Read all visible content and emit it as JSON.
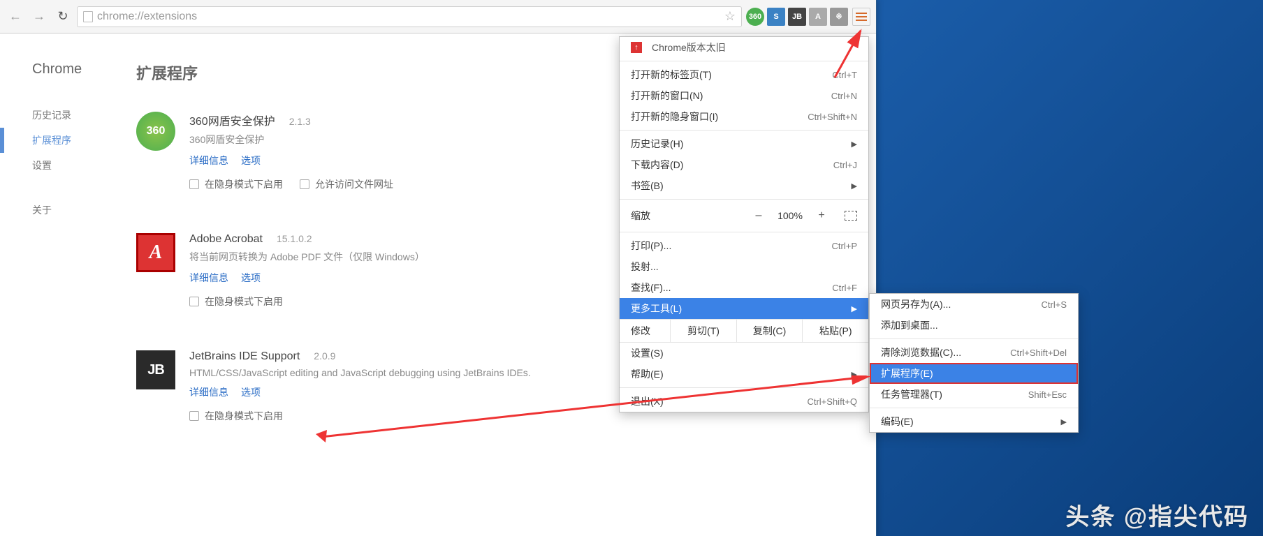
{
  "toolbar": {
    "url": "chrome://extensions",
    "ext_icons": [
      "360",
      "S",
      "JB",
      "A",
      "※"
    ]
  },
  "sidebar": {
    "title": "Chrome",
    "items": [
      {
        "label": "历史记录"
      },
      {
        "label": "扩展程序",
        "active": true
      },
      {
        "label": "设置"
      },
      {
        "label": "关于"
      }
    ]
  },
  "page_title": "扩展程序",
  "extensions": [
    {
      "logo_text": "360",
      "logo_class": "logo-360",
      "name": "360网盾安全保护",
      "version": "2.1.3",
      "desc": "360网盾安全保护",
      "details": "详细信息",
      "options": "选项",
      "incognito": "在隐身模式下启用",
      "file_access": "允许访问文件网址"
    },
    {
      "logo_text": "A",
      "logo_class": "logo-adobe",
      "name": "Adobe Acrobat",
      "version": "15.1.0.2",
      "desc": "将当前网页转换为 Adobe PDF 文件（仅限 Windows）",
      "details": "详细信息",
      "options": "选项",
      "incognito": "在隐身模式下启用"
    },
    {
      "logo_text": "JB",
      "logo_class": "logo-jb",
      "name": "JetBrains IDE Support",
      "version": "2.0.9",
      "desc": "HTML/CSS/JavaScript editing and JavaScript debugging using JetBrains IDEs.",
      "details": "详细信息",
      "options": "选项",
      "incognito": "在隐身模式下启用"
    }
  ],
  "menu": {
    "warning": "Chrome版本太旧",
    "new_tab": {
      "label": "打开新的标签页(T)",
      "shortcut": "Ctrl+T"
    },
    "new_window": {
      "label": "打开新的窗口(N)",
      "shortcut": "Ctrl+N"
    },
    "new_incognito": {
      "label": "打开新的隐身窗口(I)",
      "shortcut": "Ctrl+Shift+N"
    },
    "history": {
      "label": "历史记录(H)"
    },
    "downloads": {
      "label": "下载内容(D)",
      "shortcut": "Ctrl+J"
    },
    "bookmarks": {
      "label": "书签(B)"
    },
    "zoom": {
      "label": "缩放",
      "minus": "–",
      "value": "100%",
      "plus": "+"
    },
    "print": {
      "label": "打印(P)...",
      "shortcut": "Ctrl+P"
    },
    "cast": {
      "label": "投射..."
    },
    "find": {
      "label": "查找(F)...",
      "shortcut": "Ctrl+F"
    },
    "more_tools": {
      "label": "更多工具(L)"
    },
    "edit": {
      "label": "修改",
      "cut": "剪切(T)",
      "copy": "复制(C)",
      "paste": "粘贴(P)"
    },
    "settings": {
      "label": "设置(S)"
    },
    "help": {
      "label": "帮助(E)"
    },
    "exit": {
      "label": "退出(X)",
      "shortcut": "Ctrl+Shift+Q"
    }
  },
  "submenu": {
    "save_as": {
      "label": "网页另存为(A)...",
      "shortcut": "Ctrl+S"
    },
    "add_desktop": {
      "label": "添加到桌面..."
    },
    "clear_data": {
      "label": "清除浏览数据(C)...",
      "shortcut": "Ctrl+Shift+Del"
    },
    "extensions": {
      "label": "扩展程序(E)"
    },
    "task_mgr": {
      "label": "任务管理器(T)",
      "shortcut": "Shift+Esc"
    },
    "encoding": {
      "label": "编码(E)"
    }
  },
  "watermark": "头条 @指尖代码"
}
